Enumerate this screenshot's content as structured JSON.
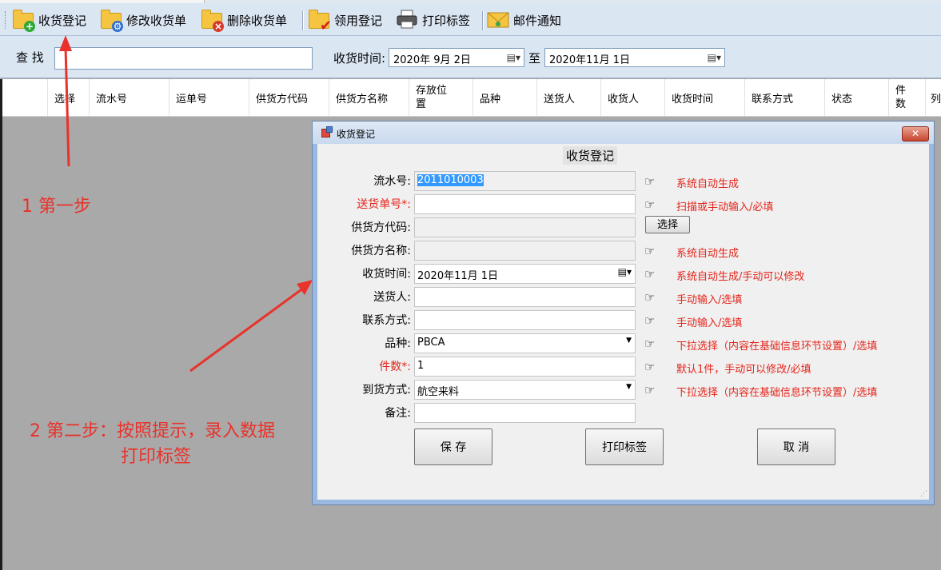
{
  "toolbar": {
    "buttons": [
      {
        "label": "收货登记",
        "icon": "folder-add-icon"
      },
      {
        "label": "修改收货单",
        "icon": "folder-gear-icon"
      },
      {
        "label": "删除收货单",
        "icon": "folder-delete-icon"
      },
      {
        "label": "领用登记",
        "icon": "folder-check-icon"
      },
      {
        "label": "打印标签",
        "icon": "printer-icon"
      },
      {
        "label": "邮件通知",
        "icon": "envelope-icon"
      }
    ]
  },
  "search": {
    "label": "查 找",
    "value": "",
    "time_label": "收货时间:",
    "date_from": "2020年  9月  2日",
    "to_label": "至",
    "date_to": "2020年11月  1日"
  },
  "grid": {
    "columns": [
      "选择",
      "流水号",
      "运单号",
      "供货方代码",
      "供货方名称",
      "存放位置",
      "品种",
      "送货人",
      "收货人",
      "收货时间",
      "联系方式",
      "状态",
      "件数",
      "列"
    ]
  },
  "annotations": {
    "step1": "1 第一步",
    "step2_line1": "2 第二步：按照提示，录入数据",
    "step2_line2": "打印标签"
  },
  "dialog": {
    "title": "收货登记",
    "heading": "收货登记",
    "close_symbol": "✕",
    "hint_icon": "pointing-hand-icon",
    "fields": [
      {
        "label": "流水号:",
        "value": "2011010003",
        "hint": "系统自动生成"
      },
      {
        "label": "送货单号*:",
        "value": "",
        "hint": "扫描或手动输入/必填"
      },
      {
        "label": "供货方代码:",
        "value": "",
        "hint": ""
      },
      {
        "label": "供货方名称:",
        "value": "",
        "hint": "系统自动生成"
      },
      {
        "label": "收货时间:",
        "value": "2020年11月  1日",
        "hint": "系统自动生成/手动可以修改"
      },
      {
        "label": "送货人:",
        "value": "",
        "hint": "手动输入/选填"
      },
      {
        "label": "联系方式:",
        "value": "",
        "hint": "手动输入/选填"
      },
      {
        "label": "品种:",
        "value": "PBCA",
        "hint": "下拉选择（内容在基础信息环节设置）/选填"
      },
      {
        "label": "件数*:",
        "value": "1",
        "hint": "默认1件，手动可以修改/必填"
      },
      {
        "label": "到货方式:",
        "value": "航空来料",
        "hint": "下拉选择（内容在基础信息环节设置）/选填"
      },
      {
        "label": "备注:",
        "value": "",
        "hint": ""
      }
    ],
    "select_button": "选择",
    "buttons": {
      "save": "保 存",
      "print": "打印标签",
      "cancel": "取   消"
    }
  },
  "colors": {
    "accent_red": "#e8322b",
    "toolbar_bg": "#dbe6f3",
    "selection_blue": "#3399ff"
  }
}
